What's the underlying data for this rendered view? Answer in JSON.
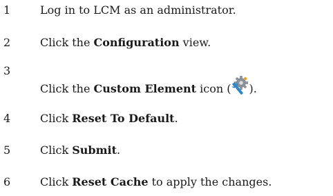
{
  "steps": [
    {
      "number": "1",
      "text": "Log in to LCM as an administrator."
    },
    {
      "number": "2",
      "pre": "Click the ",
      "bold": "Configuration",
      "post": " view."
    },
    {
      "number": "3",
      "pre": "Click the ",
      "bold": "Custom Element",
      "mid": " icon (",
      "icon": "custom-element-wrench-gear-icon",
      "post": ")."
    },
    {
      "number": "4",
      "pre": "Click ",
      "bold": "Reset To Default",
      "post": "."
    },
    {
      "number": "5",
      "pre": "Click ",
      "bold": "Submit",
      "post": "."
    },
    {
      "number": "6",
      "pre": "Click ",
      "bold": "Reset Cache",
      "post": " to apply the changes."
    }
  ],
  "colors": {
    "text": "#1a1a1a",
    "icon_gear": "#8a9097",
    "icon_wrench": "#2e86c9",
    "icon_accent": "#f0a020"
  }
}
